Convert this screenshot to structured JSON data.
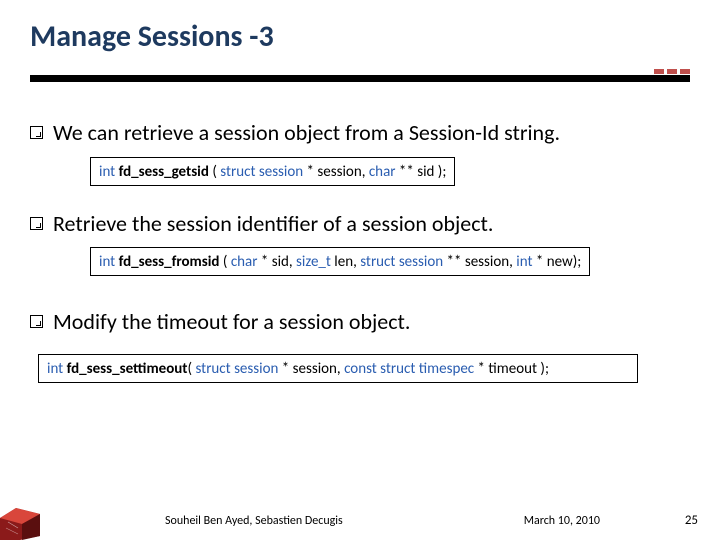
{
  "title": "Manage Sessions -3",
  "bullets": [
    "We can retrieve a session object from a Session-Id string.",
    "Retrieve the session identifier of a session object.",
    "Modify the timeout for a session object."
  ],
  "code": {
    "c1": {
      "ret": "int",
      "fn": "fd_sess_getsid",
      "open": " ( ",
      "sig1_kw": "struct ",
      "sig1_t": "session",
      "mid1": " * session, ",
      "sig2_kw": "char",
      "tail": " ** sid );"
    },
    "c2": {
      "ret": "int",
      "fn": "fd_sess_fromsid",
      "open": " ( ",
      "p1_kw": "char ",
      "p1_rest": "* sid, ",
      "p2_kw": "size_t ",
      "p2_rest": "len, ",
      "p3_kw": "struct ",
      "p3_t": "session ",
      "p3_rest": "** session, ",
      "p4_kw": "int ",
      "p4_rest": "* new);"
    },
    "c3": {
      "ret": "int",
      "fn": "fd_sess_settimeout",
      "open": "( ",
      "p1_kw": "struct ",
      "p1_t": "session ",
      "p1_rest": "* session, ",
      "p2_kw": "const struct ",
      "p2_t": "timespec ",
      "p2_rest": "* timeout );"
    }
  },
  "footer": {
    "authors": "Souheil Ben Ayed, Sebastien Decugis",
    "date": "March 10, 2010",
    "page": "25"
  },
  "accent": "#c0504d"
}
